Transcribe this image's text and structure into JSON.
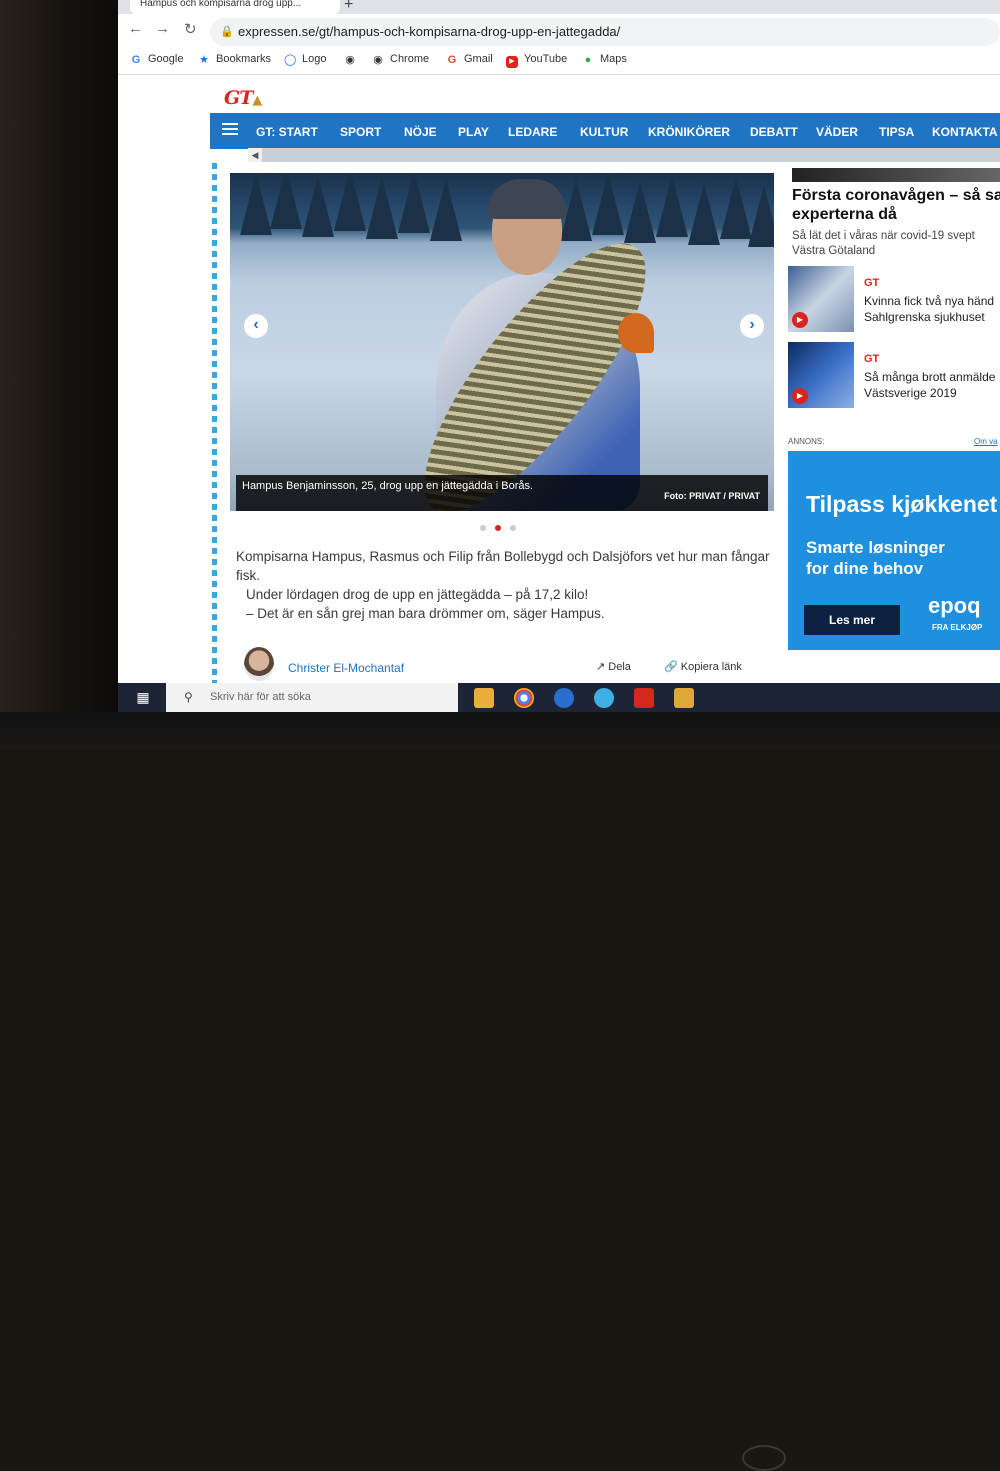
{
  "browser": {
    "tab_title": "Hampus och kompisarna drog upp...",
    "new_tab_symbol": "+",
    "url": "expressen.se/gt/hampus-och-kompisarna-drog-upp-en-jattegadda/",
    "bookmarks": [
      {
        "label": "Google",
        "icon": "google-icon"
      },
      {
        "label": "Bookmarks",
        "icon": "star-icon"
      },
      {
        "label": "Logo",
        "icon": "logo-icon"
      },
      {
        "label": "",
        "icon": "globe-icon"
      },
      {
        "label": "Chrome",
        "icon": "globe-icon"
      },
      {
        "label": "Gmail",
        "icon": "google-icon"
      },
      {
        "label": "YouTube",
        "icon": "youtube-icon"
      },
      {
        "label": "Maps",
        "icon": "maps-icon"
      }
    ]
  },
  "site": {
    "logo": "GT",
    "nav": [
      "GT: START",
      "SPORT",
      "NÖJE",
      "PLAY",
      "LEDARE",
      "KULTUR",
      "KRÖNIKÖRER",
      "DEBATT",
      "VÄDER",
      "TIPSA",
      "KONTAKTA"
    ]
  },
  "article": {
    "image_caption": "Hampus Benjaminsson, 25, drog upp en jättegädda i Borås.",
    "image_credit": "Foto: PRIVAT / PRIVAT",
    "lead_1": "Kompisarna Hampus, Rasmus och Filip från Bollebygd och Dalsjöfors vet hur man fångar fisk.",
    "lead_2": "Under lördagen drog de upp en jättegädda – på 17,2 kilo!",
    "lead_3": "– Det är en sån grej man bara drömmer om, säger Hampus.",
    "author": "Christer El-Mochantaf",
    "share_label": "Dela",
    "copy_label": "Kopiera länk"
  },
  "sidebar": {
    "headline_1": "Första coronavågen – så sa",
    "headline_2": "experterna då",
    "sub_1": "Så lät det i våras när covid-19 svept",
    "sub_2": "Västra Götaland",
    "teasers": [
      {
        "tag": "GT",
        "line_1": "Kvinna fick två nya händ",
        "line_2": "Sahlgrenska sjukhuset"
      },
      {
        "tag": "GT",
        "line_1": "Så många brott anmälde",
        "line_2": "Västsverige 2019"
      }
    ],
    "annons_label": "ANNONS:",
    "annons_link": "Om va",
    "ad": {
      "headline": "Tilpass kjøkkenet",
      "sub_1": "Smarte løsninger",
      "sub_2": "for dine behov",
      "button": "Les mer",
      "brand": "epoq",
      "brand_sub": "FRA ELKJØP"
    }
  },
  "taskbar": {
    "search_placeholder": "Skriv här för att söka"
  },
  "colors": {
    "brand_red": "#d9251c",
    "nav_blue": "#1f75c3",
    "ad_blue": "#1f8fdf"
  }
}
